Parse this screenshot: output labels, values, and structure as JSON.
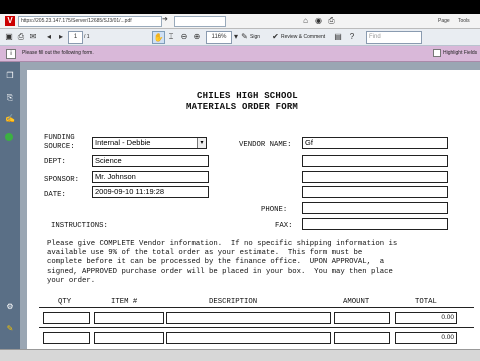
{
  "browser": {
    "url": "https://205.23.147.175/Server/12685/SJ3/01/...pdf",
    "menu_page": "Page",
    "menu_tools": "Tools"
  },
  "toolbar": {
    "page_number": "1",
    "page_total": "/ 1",
    "zoom": "116%",
    "sign_label": "Sign",
    "review_label": "Review & Comment",
    "find_placeholder": "Find"
  },
  "message_bar": {
    "text": "Please fill out the following form.",
    "highlight_label": "Highlight Fields"
  },
  "form": {
    "title_line1": "CHILES HIGH SCHOOL",
    "title_line2": "MATERIALS ORDER FORM",
    "funding_label": "FUNDING",
    "funding_label2": "SOURCE:",
    "funding_value": "Internal - Debbie",
    "dept_label": "DEPT:",
    "dept_value": "Science",
    "sponsor_label": "SPONSOR:",
    "sponsor_value": "Mr. Johnson",
    "date_label": "DATE:",
    "date_value": "2009-09-10 11:19:28",
    "vendor_label": "VENDOR NAME:",
    "vendor_value": "Gf",
    "phone_label": "PHONE:",
    "fax_label": "FAX:",
    "instructions_label": "INSTRUCTIONS:",
    "instructions_text": "Please give COMPLETE Vendor information.  If no specific shipping information is\navailable use 9% of the total order as your estimate.  This form must be\ncomplete before it can be processed by the finance office.  UPON APPROVAL,  a\nsigned, APPROVED purchase order will be placed in your box.  You may then place\nyour order.",
    "col_qty": "QTY",
    "col_item": "ITEM #",
    "col_desc": "DESCRIPTION",
    "col_amount": "AMOUNT",
    "col_total": "TOTAL",
    "rows": [
      {
        "total": "0.00"
      },
      {
        "total": "0.00"
      }
    ]
  },
  "colors": {
    "message_bar": "#d9b8d9",
    "left_nav": "#5a6f86",
    "doc_background": "#9aa6b3"
  },
  "icons": [
    "back-icon",
    "home-icon",
    "print-icon",
    "save-icon",
    "hand-tool-icon",
    "select-tool-icon",
    "zoom-out-icon",
    "zoom-in-icon",
    "pages-icon",
    "bookmarks-icon",
    "signatures-icon",
    "attachments-icon",
    "form-icon"
  ]
}
